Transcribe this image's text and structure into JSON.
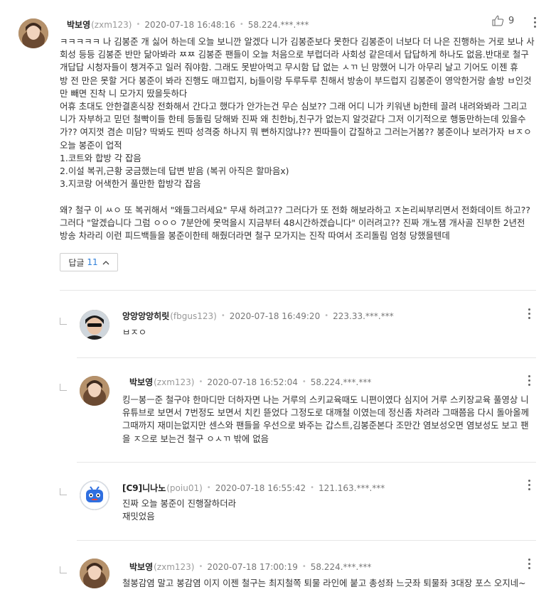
{
  "main_comment": {
    "nickname": "박보영",
    "user_id": "(zxm123)",
    "timestamp": "2020-07-18 16:48:16",
    "ip": "58.224.***.***",
    "likes": "9",
    "lines": [
      "ㅋㅋㅋㅋㅋ 나 김봉준 개 싫어 하는데 오늘 보니깐 알겠다 니가 김봉준보다 못한다 김봉준이 너보다 더 나은 진행하는 거로 보나 사",
      "회성 등등 김봉준 반만 닮아봐라 ㅉㅉ 김봉준 팬들이 오늘 처음으로 부럽더라 사회성 같은데서 답답하게 하나도 없음.반대로 철구",
      "개답답 시청자들이 챙겨주고 일러 줘야함. 그래도 못받아먹고 무시함 답 없는 ㅅㄲ 닌 망했어 니가 아무리 날고 기어도 이젠 휴",
      "방 전 만은 못할 거다 봉준이 봐라 진행도 매끄럽지, bj들이랑 두루두루 친해서 방송이 부드럽지 김봉준이 영악한거랑 솔방 ㅂ인것",
      "만 빼면 진착 니 모가지 땄을듯하다",
      "어휴 초대도 안한결혼식장 전화해서 간다고 했다가 안가는건 무슨 심보?? 그래 어디 니가 키워낸 bj한테 끌려 내려와봐라 그리고",
      "니가 자부하고 믿던 철빡이들 한테 등돌림 당해봐  진짜 왜 친한bj,친구가 없는지 알것같다 그저 이기적으로 행동만하는데 있을수",
      "가?? 여지껏 겸손 미담? 딱봐도 찐따 성격중 하나지 뭐 뻔하지않냐?? 찐따들이 갑질하고 그러는거봄?? 봉준이나 보러가자 ㅂㅈㅇ",
      "오늘 봉준이 업적",
      "1.코트와 합방 각 잡음",
      "2.이설 복귀,근황 궁금했는데 답변 받음 (복귀 아직은 할마음x)",
      "3.지코랑 어색한거 풀만한 합방각 잡음",
      "",
      "왜? 철구 이 ㅆㅇ 또 복귀해서 \"왜들그러세요\" 무새 하려고?? 그러다가 또 전화 해보라하고 ㅈ논리씨부리면서 전화데이트 하고??",
      "그러다 \"알겠습니다 그럼 ㅇㅇㅇ 7분안에 못먹을시 지금부터 48시간하겠습니다\" 이러려고??  진짜 개노잼 개사골 진부한 2년전",
      "방송 차라리 이런 피드백들을 봉준이한테 해줬더라면 철구 모가지는 진작 따여서 조리돌림 엄청 당했을텐데"
    ]
  },
  "replies_button": {
    "label": "답글",
    "count": "11"
  },
  "replies": [
    {
      "nickname": "앙앙앙앙히릿",
      "user_id": "(fbgus123)",
      "timestamp": "2020-07-18 16:49:20",
      "ip": "223.33.***.***",
      "lines": [
        "ㅂㅈㅇ"
      ]
    },
    {
      "nickname": "박보영",
      "user_id": "(zxm123)",
      "timestamp": "2020-07-18 16:52:04",
      "ip": "58.224.***.***",
      "lines": [
        "킹ㅡ봉ㅡ준 철구야 한마디만 더하자면 나는 거루의 스키교육때도 니편이였다 심지어 거루 스키장교육 풀영상 니",
        "유튜브로 보면서 7번정도 보면서 치킨 뜯었다 그정도로 대깨철 이였는데 정신좀 차려라 그때쯤음 다시 돌아올께",
        "그때까지 재미는없지만 센스와 팬들을 우선으로 봐주는 갑스트,김봉준본다 조만간 염보성오면 염보성도 보고 팬",
        "을 ㅈ으로 보는건 철구 ㅇㅅㄲ 밖에 없음"
      ]
    },
    {
      "nickname": "[C9]니나노",
      "user_id": "(poiu01)",
      "timestamp": "2020-07-18 16:55:42",
      "ip": "121.163.***.***",
      "lines": [
        "진짜 오늘 봉준이 진행잘하더라",
        "재밋었음"
      ]
    },
    {
      "nickname": "박보영",
      "user_id": "(zxm123)",
      "timestamp": "2020-07-18 17:00:19",
      "ip": "58.224.***.***",
      "lines": [
        "철봉감염 말고 봉감염 이지 이젠 철구는 최지철쪽 퇴물 라인에 붙고 총성좌 느긋좌 퇴물좌 3대장 포스 오지네~"
      ]
    }
  ]
}
